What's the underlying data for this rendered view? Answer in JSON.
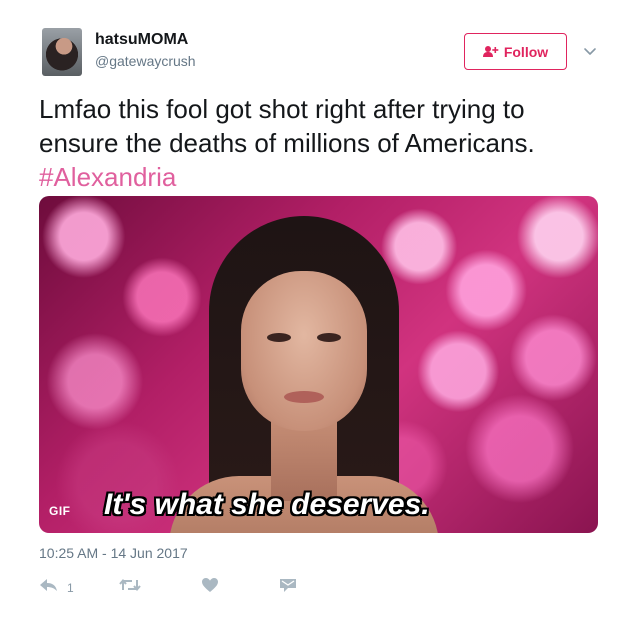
{
  "user": {
    "display_name": "hatsuMOMA",
    "handle": "@gatewaycrush",
    "avatar_icon": "user-avatar"
  },
  "follow_button": {
    "label": "Follow",
    "icon": "add-user-icon",
    "color": "#e0245e"
  },
  "menu_icon": "chevron-down-icon",
  "tweet": {
    "text_main": "Lmfao this fool got shot right after trying to ensure the deaths of millions of Americans.",
    "hashtag": "#Alexandria",
    "hashtag_color": "#e0609e"
  },
  "media": {
    "badge": "GIF",
    "caption": "It's what she deserves."
  },
  "timestamp": "10:25 AM - 14 Jun 2017",
  "actions": {
    "reply": {
      "icon": "reply-icon",
      "count": "1"
    },
    "retweet": {
      "icon": "retweet-icon"
    },
    "like": {
      "icon": "heart-icon"
    },
    "message": {
      "icon": "direct-message-icon"
    }
  }
}
